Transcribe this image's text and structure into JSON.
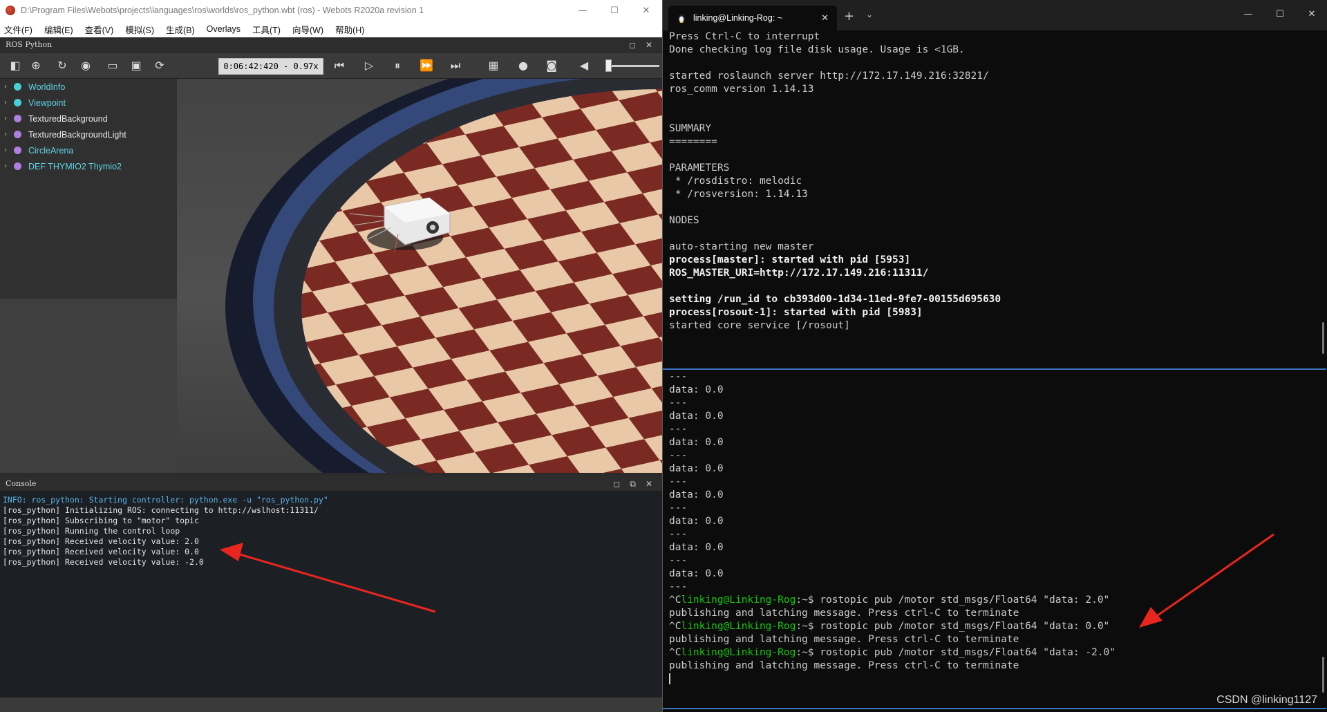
{
  "webots": {
    "title": "D:\\Program Files\\Webots\\projects\\languages\\ros\\worlds\\ros_python.wbt (ros) - Webots R2020a revision 1",
    "menu": [
      "文件(F)",
      "编辑(E)",
      "查看(V)",
      "模拟(S)",
      "生成(B)",
      "Overlays",
      "工具(T)",
      "向导(W)",
      "帮助(H)"
    ],
    "panel_title": "ROS Python",
    "sim_time": "0:06:42:420  -  0.97x",
    "scene_tree": [
      {
        "label": "WorldInfo",
        "color": "#49d0d6",
        "text_color": "#5fd4e6"
      },
      {
        "label": "Viewpoint",
        "color": "#49d0d6",
        "text_color": "#5fd4e6"
      },
      {
        "label": "TexturedBackground",
        "color": "#b07ee0",
        "text_color": "#e8e8e8"
      },
      {
        "label": "TexturedBackgroundLight",
        "color": "#b07ee0",
        "text_color": "#e8e8e8"
      },
      {
        "label": "CircleArena",
        "color": "#b07ee0",
        "text_color": "#5fd4e6"
      },
      {
        "label": "DEF THYMIO2 Thymio2",
        "color": "#b07ee0",
        "text_color": "#5fd4e6"
      }
    ],
    "console": {
      "title": "Console",
      "lines": [
        {
          "text": "INFO: ros_python: Starting controller: python.exe -u \"ros_python.py\"",
          "kind": "info"
        },
        {
          "text": "[ros_python] Initializing ROS: connecting to http://wslhost:11311/",
          "kind": "normal"
        },
        {
          "text": "[ros_python] Subscribing to \"motor\" topic",
          "kind": "normal"
        },
        {
          "text": "[ros_python] Running the control loop",
          "kind": "normal"
        },
        {
          "text": "[ros_python] Received velocity value: 2.0",
          "kind": "normal"
        },
        {
          "text": "[ros_python] Received velocity value: 0.0",
          "kind": "normal"
        },
        {
          "text": "[ros_python] Received velocity value: -2.0",
          "kind": "normal"
        }
      ]
    }
  },
  "terminal": {
    "tab_title": "linking@Linking-Rog: ~",
    "top_lines": [
      {
        "t": "Press Ctrl-C to interrupt"
      },
      {
        "t": "Done checking log file disk usage. Usage is <1GB."
      },
      {
        "t": ""
      },
      {
        "t": "started roslaunch server http://172.17.149.216:32821/"
      },
      {
        "t": "ros_comm version 1.14.13"
      },
      {
        "t": ""
      },
      {
        "t": ""
      },
      {
        "t": "SUMMARY"
      },
      {
        "t": "========"
      },
      {
        "t": ""
      },
      {
        "t": "PARAMETERS"
      },
      {
        "t": " * /rosdistro: melodic"
      },
      {
        "t": " * /rosversion: 1.14.13"
      },
      {
        "t": ""
      },
      {
        "t": "NODES"
      },
      {
        "t": ""
      },
      {
        "t": "auto-starting new master"
      },
      {
        "t": "process[master]: started with pid [5953]",
        "bold": true
      },
      {
        "t": "ROS_MASTER_URI=http://172.17.149.216:11311/",
        "bold": true
      },
      {
        "t": ""
      },
      {
        "t": "setting /run_id to cb393d00-1d34-11ed-9fe7-00155d695630",
        "bold": true
      },
      {
        "t": "process[rosout-1]: started with pid [5983]",
        "bold": true
      },
      {
        "t": "started core service [/rosout]"
      }
    ],
    "bottom_lines": [
      {
        "t": "---"
      },
      {
        "t": "data: 0.0"
      },
      {
        "t": "---"
      },
      {
        "t": "data: 0.0"
      },
      {
        "t": "---"
      },
      {
        "t": "data: 0.0"
      },
      {
        "t": "---"
      },
      {
        "t": "data: 0.0"
      },
      {
        "t": "---"
      },
      {
        "t": "data: 0.0"
      },
      {
        "t": "---"
      },
      {
        "t": "data: 0.0"
      },
      {
        "t": "---"
      },
      {
        "t": "data: 0.0"
      },
      {
        "t": "---"
      },
      {
        "t": "data: 0.0"
      },
      {
        "t": "---"
      },
      {
        "pre": "^C",
        "user": "linking@Linking-Rog",
        "post": ":~$ rostopic pub /motor std_msgs/Float64 \"data: 2.0\""
      },
      {
        "t": "publishing and latching message. Press ctrl-C to terminate"
      },
      {
        "pre": "^C",
        "user": "linking@Linking-Rog",
        "post": ":~$ rostopic pub /motor std_msgs/Float64 \"data: 0.0\""
      },
      {
        "t": "publishing and latching message. Press ctrl-C to terminate"
      },
      {
        "pre": "^C",
        "user": "linking@Linking-Rog",
        "post": ":~$ rostopic pub /motor std_msgs/Float64 \"data: -2.0\""
      },
      {
        "t": "publishing and latching message. Press ctrl-C to terminate"
      }
    ]
  },
  "watermark": "CSDN @linking1127",
  "colors": {
    "annotation": "#e8261f",
    "prompt_green": "#16c60c",
    "pane_divider": "#3b78c4"
  }
}
